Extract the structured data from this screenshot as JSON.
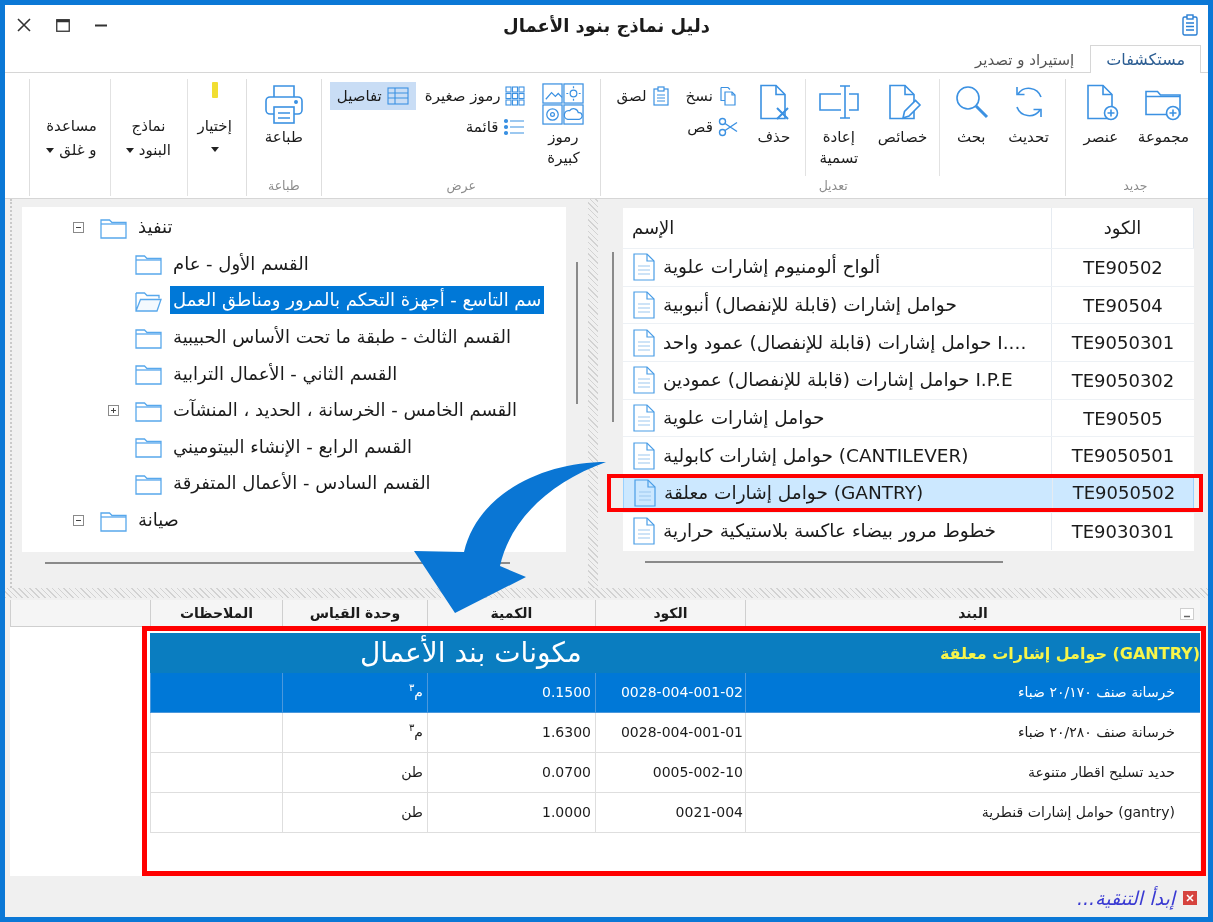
{
  "window": {
    "title": "دليل نماذج بنود الأعمال"
  },
  "ribbon": {
    "tabs": [
      {
        "label": "مستكشفات",
        "selected": true
      },
      {
        "label": "إستيراد و تصدير",
        "selected": false
      }
    ],
    "groups": [
      {
        "label": "جديد",
        "sections": [
          [
            {
              "kind": "large",
              "label": "مجموعة"
            },
            {
              "kind": "large",
              "label": "عنصر"
            }
          ]
        ]
      },
      {
        "label": "تعديل",
        "sections": [
          [
            {
              "kind": "large",
              "label": "تحديث"
            },
            {
              "kind": "large",
              "label": "بحث"
            }
          ],
          [
            {
              "kind": "large",
              "label": "خصائص"
            },
            {
              "kind": "large",
              "label": "إعادة تسمية"
            }
          ],
          [
            {
              "kind": "large",
              "label": "حذف"
            },
            {
              "kind": "small",
              "label": "نسخ"
            },
            {
              "kind": "small",
              "label": "قص"
            },
            {
              "kind": "small",
              "label": "لصق"
            }
          ]
        ]
      },
      {
        "label": "عرض",
        "sections": [
          [
            {
              "kind": "large",
              "label": "رموز كبيرة",
              "selected": false
            },
            {
              "kind": "small",
              "label": "رموز صغيرة",
              "selected": false
            },
            {
              "kind": "small",
              "label": "قائمة",
              "selected": false
            },
            {
              "kind": "small",
              "label": "تفاصيل",
              "selected": true
            }
          ]
        ]
      },
      {
        "label": "طباعة",
        "sections": [
          [
            {
              "kind": "large",
              "label": "طباعة"
            }
          ]
        ]
      },
      {
        "sections": [
          [
            {
              "kind": "split",
              "label": "إختيار"
            }
          ],
          [
            {
              "kind": "dropdown",
              "label": "نماذج البنود"
            }
          ],
          [
            {
              "kind": "dropdown",
              "label": "مساعدة و غلق"
            }
          ]
        ]
      }
    ]
  },
  "tree": [
    {
      "label": "تنفيذ",
      "expanded": true,
      "selected": false,
      "children": [
        {
          "label": "القسم الأول - عام",
          "selected": false
        },
        {
          "label": "سم التاسع - أجهزة التحكم بالمرور ومناطق العمل",
          "selected": true
        },
        {
          "label": "القسم الثالث - طبقة ما تحت الأساس الحبيبية",
          "selected": false
        },
        {
          "label": "القسم الثاني - الأعمال الترابية",
          "selected": false
        },
        {
          "label": "القسم الخامس - الخرسانة ، الحديد ، المنشآت",
          "expanded": false,
          "selected": false
        },
        {
          "label": "القسم الرابع - الإنشاء البيتوميني",
          "selected": false
        },
        {
          "label": "القسم السادس - الأعمال المتفرقة",
          "selected": false
        }
      ]
    },
    {
      "label": "صيانة",
      "expanded": true,
      "selected": false
    }
  ],
  "item_list": {
    "columns": [
      "الكود",
      "الإسم"
    ],
    "rows": [
      {
        "code": "TE90502",
        "name": "ألواح ألومنيوم إشارات علوية",
        "selected": false
      },
      {
        "code": "TE90504",
        "name": "حوامل إشارات (قابلة للإنفصال) أنبوبية",
        "selected": false
      },
      {
        "code": "TE9050301",
        "name": "....I حوامل إشارات (قابلة للإنفصال) عمود واحد",
        "selected": false
      },
      {
        "code": "TE9050302",
        "name": "I.P.E حوامل إشارات (قابلة للإنفصال) عمودين",
        "selected": false
      },
      {
        "code": "TE90505",
        "name": "حوامل إشارات علوية",
        "selected": false
      },
      {
        "code": "TE9050501",
        "name": "(CANTILEVER) حوامل إشارات كابولية",
        "selected": false
      },
      {
        "code": "TE9050502",
        "name": "(GANTRY) حوامل إشارات معلقة",
        "selected": true
      },
      {
        "code": "TE9030301",
        "name": "خطوط مرور بيضاء عاكسة بلاستيكية حرارية",
        "selected": false
      }
    ]
  },
  "components_grid": {
    "columns": [
      "البند",
      "الكود",
      "الكمية",
      "وحدة القياس",
      "الملاحظات"
    ],
    "group": "(GANTRY) حوامل إشارات معلقة",
    "caption": "مكونات بند الأعمال",
    "rows": [
      {
        "item": "خرسانة صنف ٢٠/١٧٠ ضباء",
        "code": "0028-004-001-02",
        "quantity": "0.1500",
        "unit": "م$^{٣}$",
        "selected": true
      },
      {
        "item": "خرسانة صنف ٢٠/٢٨٠ ضباء",
        "code": "0028-004-001-01",
        "quantity": "1.6300",
        "unit": "م$^{٣}$",
        "selected": false
      },
      {
        "item": "حديد تسليح اقطار متنوعة",
        "code": "0005-002-10",
        "quantity": "0.0700",
        "unit": "طن",
        "selected": false
      },
      {
        "item": "(gantry) حوامل إشارات قنطرية",
        "code": "0021-004",
        "quantity": "1.0000",
        "unit": "طن",
        "selected": false
      }
    ]
  },
  "status_bar": {
    "link": "إبدأ التنقية..."
  }
}
